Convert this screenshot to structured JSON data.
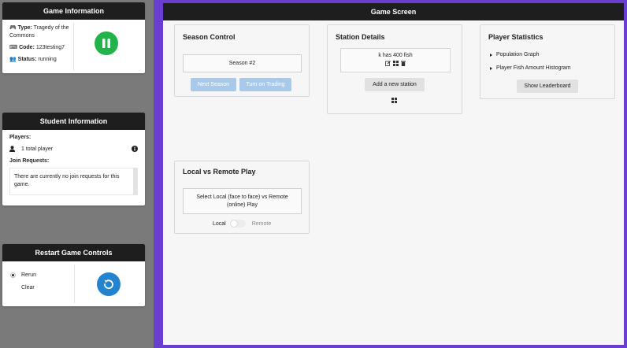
{
  "game_info": {
    "title": "Game Information",
    "type_label": "Type:",
    "type_value": "Tragedy of the Commons",
    "code_label": "Code:",
    "code_value": "123testing7",
    "status_label": "Status:",
    "status_value": "running",
    "pause_icon": "pause-icon",
    "pause_color": "#22b34a"
  },
  "student_info": {
    "title": "Student Information",
    "players_label": "Players:",
    "players_count": "1 total player",
    "join_label": "Join Requests:",
    "join_empty": "There are currently no join requests for this game."
  },
  "restart": {
    "title": "Restart Game Controls",
    "options": [
      "Rerun",
      "Clear"
    ],
    "selected": "Rerun",
    "button_color": "#2383cf"
  },
  "game_screen": {
    "title": "Game Screen",
    "frame_color": "#6a3fd0",
    "season_control": {
      "title": "Season Control",
      "season": "Season #2",
      "next_label": "Next Season",
      "trading_label": "Turn on Trading"
    },
    "station_details": {
      "title": "Station Details",
      "station_text": "k has 400 fish",
      "add_label": "Add a new station"
    },
    "player_statistics": {
      "title": "Player Statistics",
      "items": [
        "Population Graph",
        "Player Fish Amount Histogram"
      ],
      "leaderboard_label": "Show Leaderboard"
    },
    "local_remote": {
      "title": "Local vs Remote Play",
      "prompt": "Select Local (face to face) vs Remote (online) Play",
      "local_label": "Local",
      "remote_label": "Remote"
    }
  }
}
